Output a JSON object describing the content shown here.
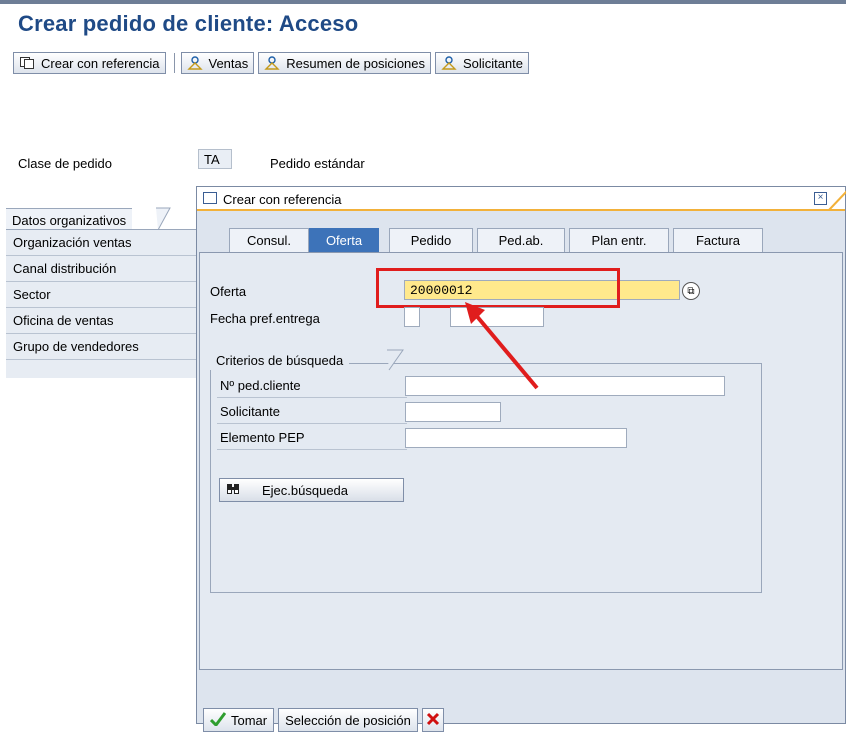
{
  "title": "Crear pedido de cliente: Acceso",
  "toolbar": {
    "create_ref": "Crear con referencia",
    "ventas": "Ventas",
    "resumen": "Resumen de posiciones",
    "solicitante": "Solicitante"
  },
  "header": {
    "clase_label": "Clase de pedido",
    "clase_value": "TA",
    "clase_desc": "Pedido estándar"
  },
  "org": {
    "tab_label": "Datos organizativos",
    "items": [
      "Organización ventas",
      "Canal distribución",
      "Sector",
      "Oficina de ventas",
      "Grupo de vendedores"
    ]
  },
  "dialog": {
    "title": "Crear con referencia",
    "tabs": [
      "Consul.",
      "Oferta",
      "Pedido",
      "Ped.ab.",
      "Plan entr.",
      "Factura"
    ],
    "active_tab": "Oferta",
    "oferta_label": "Oferta",
    "oferta_value": "20000012",
    "fecha_label": "Fecha pref.entrega",
    "criteria": {
      "title": "Criterios de búsqueda",
      "fields": [
        "Nº ped.cliente",
        "Solicitante",
        "Elemento PEP"
      ],
      "search_button": "Ejec.búsqueda"
    },
    "footer": {
      "tomar": "Tomar",
      "seleccion": "Selección de posición"
    }
  },
  "colors": {
    "title": "#1f4a86",
    "active_tab": "#3d73b9",
    "highlight": "#e01d1d",
    "input_required": "#ffe98c"
  }
}
